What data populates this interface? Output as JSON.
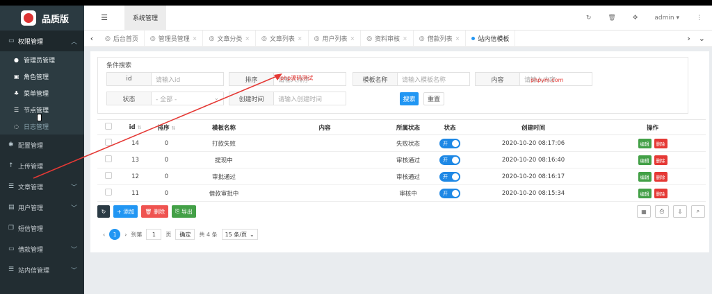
{
  "app": {
    "name": "品质版"
  },
  "sidebar": {
    "groups": [
      {
        "label": "权限管理",
        "icon": "monitor-icon",
        "open": true
      },
      {
        "label": "配置管理",
        "icon": "gear-icon"
      },
      {
        "label": "上传管理",
        "icon": "upload-icon"
      },
      {
        "label": "文章管理",
        "icon": "list-icon"
      },
      {
        "label": "用户管理",
        "icon": "user-card-icon"
      },
      {
        "label": "短信管理",
        "icon": "copy-icon"
      },
      {
        "label": "借款管理",
        "icon": "money-icon"
      },
      {
        "label": "站内信管理",
        "icon": "list-icon"
      }
    ],
    "sub": [
      "管理员管理",
      "角色管理",
      "菜单管理",
      "节点管理",
      "日志管理"
    ]
  },
  "header": {
    "title": "系统管理",
    "user": "admin"
  },
  "tabs": [
    "后台首页",
    "管理员管理",
    "文章分类",
    "文章列表",
    "用户列表",
    "资料审核",
    "借款列表",
    "站内信模板"
  ],
  "search": {
    "title": "条件搜索",
    "fields": [
      {
        "label": "id",
        "placeholder": "请输入id"
      },
      {
        "label": "排序",
        "placeholder": "请输入排序"
      },
      {
        "label": "模板名称",
        "placeholder": "请输入模板名称"
      },
      {
        "label": "内容",
        "placeholder": "请输入内容"
      },
      {
        "label": "状态",
        "value": "- 全部 -"
      },
      {
        "label": "创建时间",
        "placeholder": "请输入创建时间"
      }
    ],
    "search_btn": "搜索",
    "reset_btn": "重置"
  },
  "table": {
    "headers": [
      "id",
      "排序",
      "模板名称",
      "内容",
      "所属状态",
      "状态",
      "创建时间",
      "操作"
    ],
    "rows": [
      {
        "id": "14",
        "sort": "0",
        "name": "打款失败",
        "content": "",
        "status": "失败状态",
        "switch": "开",
        "time": "2020-10-20 08:17:06"
      },
      {
        "id": "13",
        "sort": "0",
        "name": "提现中",
        "content": "",
        "status": "审核通过",
        "switch": "开",
        "time": "2020-10-20 08:16:40"
      },
      {
        "id": "12",
        "sort": "0",
        "name": "审批通过",
        "content": "",
        "status": "审核通过",
        "switch": "开",
        "time": "2020-10-20 08:16:17"
      },
      {
        "id": "11",
        "sort": "0",
        "name": "借款审批中",
        "content": "",
        "status": "审核中",
        "switch": "开",
        "time": "2020-10-20 08:15:34"
      }
    ],
    "edit": "编辑",
    "delete": "删除"
  },
  "toolbar": {
    "add": "+ 添加",
    "del": "删除",
    "export": "导出"
  },
  "pager": {
    "current": "1",
    "goto": "到第",
    "page_input": "1",
    "page": "页",
    "confirm": "确定",
    "total": "共 4 条",
    "size": "15 条/页"
  },
  "watermark": {
    "a": "php源码测试",
    "b": "phpym.com"
  }
}
